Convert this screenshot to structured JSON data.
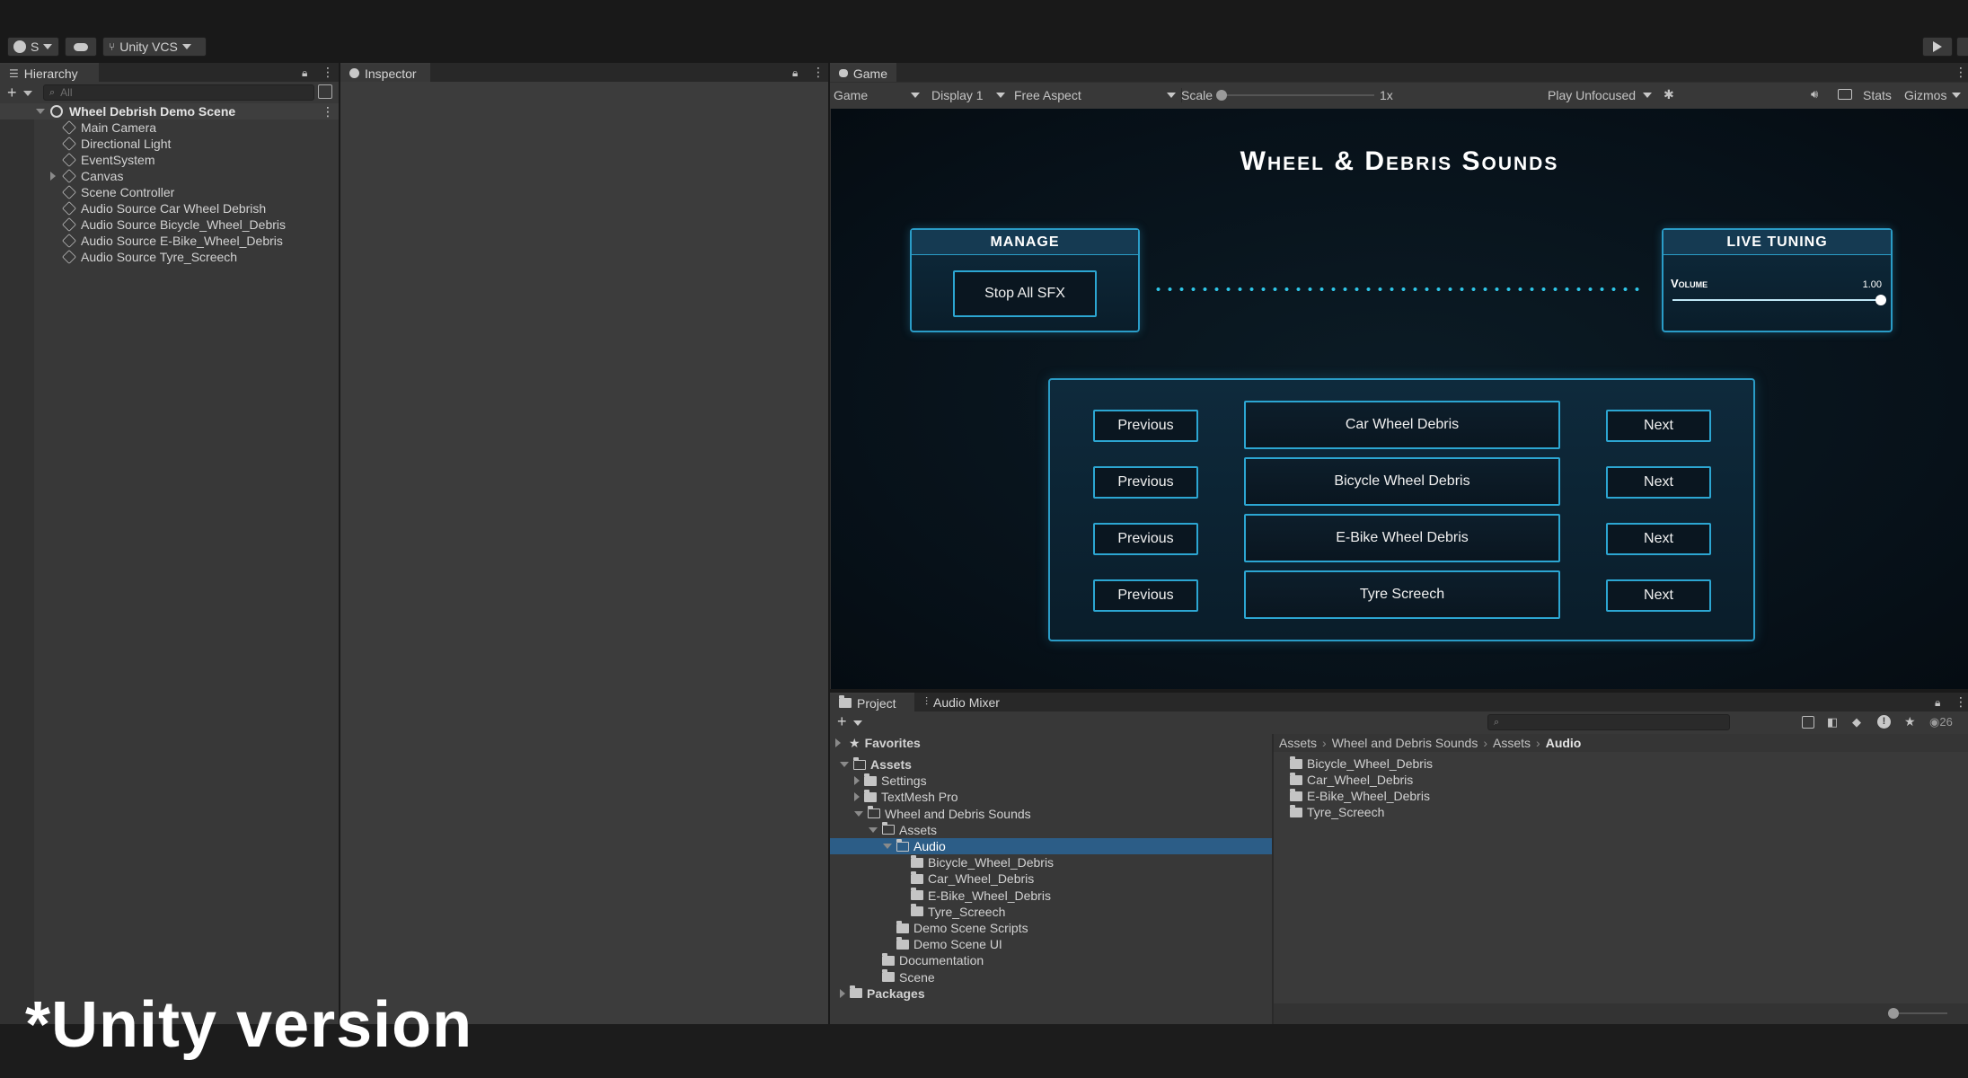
{
  "toolbar": {
    "account_label": "S",
    "vcs_label": "Unity VCS"
  },
  "hierarchy": {
    "tab_label": "Hierarchy",
    "search_placeholder": "All",
    "scene_name": "Wheel Debrish Demo Scene",
    "items": [
      {
        "label": "Main Camera"
      },
      {
        "label": "Directional Light"
      },
      {
        "label": "EventSystem"
      },
      {
        "label": "Canvas"
      },
      {
        "label": "Scene Controller"
      },
      {
        "label": "Audio Source Car Wheel Debrish"
      },
      {
        "label": "Audio Source Bicycle_Wheel_Debris"
      },
      {
        "label": "Audio Source E-Bike_Wheel_Debris"
      },
      {
        "label": "Audio Source Tyre_Screech"
      }
    ]
  },
  "inspector": {
    "tab_label": "Inspector"
  },
  "game": {
    "tab_label": "Game",
    "mode": "Game",
    "display": "Display 1",
    "aspect": "Free Aspect",
    "scale_label": "Scale",
    "scale_value": "1x",
    "scale_level": 0.0,
    "play_mode": "Play Unfocused",
    "stats_label": "Stats",
    "gizmos_label": "Gizmos",
    "title": "Wheel & Debris Sounds",
    "manage_header": "MANAGE",
    "stop_button": "Stop All SFX",
    "tuning_header": "LIVE TUNING",
    "volume_label": "Volume",
    "volume_value": "1.00",
    "volume_level": 1.0,
    "rows": [
      {
        "prev": "Previous",
        "name": "Car Wheel Debris",
        "next": "Next"
      },
      {
        "prev": "Previous",
        "name": "Bicycle Wheel Debris",
        "next": "Next"
      },
      {
        "prev": "Previous",
        "name": "E-Bike Wheel Debris",
        "next": "Next"
      },
      {
        "prev": "Previous",
        "name": "Tyre Screech",
        "next": "Next"
      }
    ]
  },
  "project": {
    "tab_label": "Project",
    "mixer_tab_label": "Audio Mixer",
    "hidden_count": "26",
    "favorites": "Favorites",
    "tree": [
      {
        "label": "Assets",
        "depth": 0,
        "bold": true
      },
      {
        "label": "Settings",
        "depth": 1
      },
      {
        "label": "TextMesh Pro",
        "depth": 1
      },
      {
        "label": "Wheel and Debris Sounds",
        "depth": 1
      },
      {
        "label": "Assets",
        "depth": 2
      },
      {
        "label": "Audio",
        "depth": 3,
        "selected": true
      },
      {
        "label": "Bicycle_Wheel_Debris",
        "depth": 4
      },
      {
        "label": "Car_Wheel_Debris",
        "depth": 4
      },
      {
        "label": "E-Bike_Wheel_Debris",
        "depth": 4
      },
      {
        "label": "Tyre_Screech",
        "depth": 4
      },
      {
        "label": "Demo Scene Scripts",
        "depth": 3
      },
      {
        "label": "Demo Scene UI",
        "depth": 3
      },
      {
        "label": "Documentation",
        "depth": 2
      },
      {
        "label": "Scene",
        "depth": 2
      },
      {
        "label": "Packages",
        "depth": 0,
        "bold": true
      }
    ],
    "breadcrumb": [
      "Assets",
      "Wheel and Debris Sounds",
      "Assets",
      "Audio"
    ],
    "contents": [
      "Bicycle_Wheel_Debris",
      "Car_Wheel_Debris",
      "E-Bike_Wheel_Debris",
      "Tyre_Screech"
    ]
  },
  "caption": "*Unity version"
}
